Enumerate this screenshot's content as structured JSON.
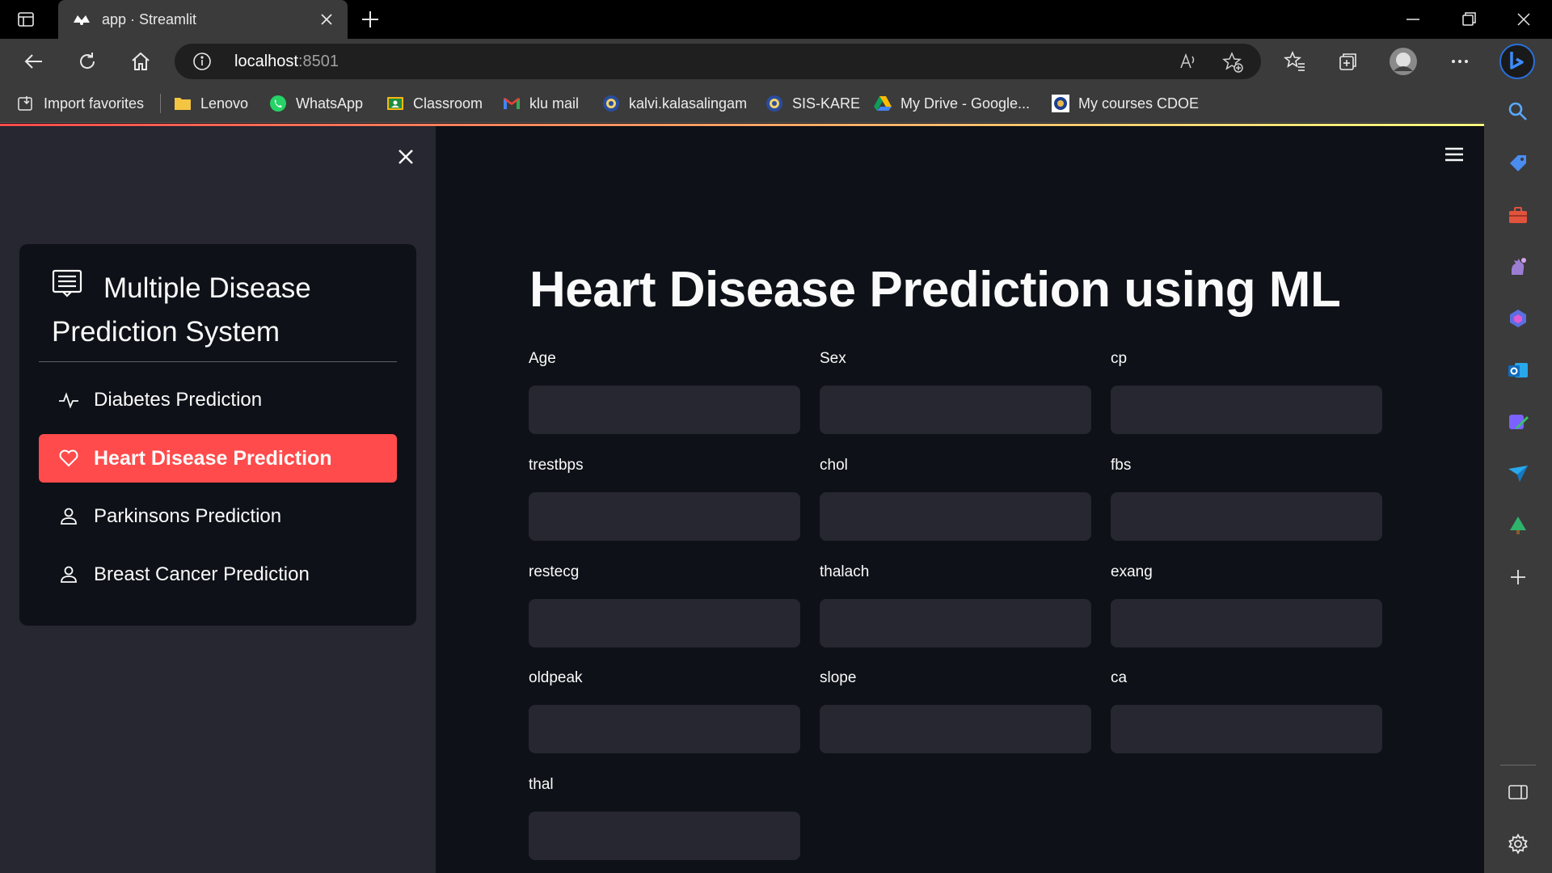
{
  "browser": {
    "tab_title": "app · Streamlit",
    "url_host": "localhost",
    "url_port": ":8501",
    "bookmarks": [
      {
        "label": "Import favorites",
        "icon": "import-icon"
      },
      {
        "label": "Lenovo",
        "icon": "folder-icon"
      },
      {
        "label": "WhatsApp",
        "icon": "whatsapp-icon"
      },
      {
        "label": "Classroom",
        "icon": "classroom-icon"
      },
      {
        "label": "klu mail",
        "icon": "gmail-icon"
      },
      {
        "label": "kalvi.kalasalingam",
        "icon": "kalvi-icon"
      },
      {
        "label": "SIS-KARE",
        "icon": "sis-icon"
      },
      {
        "label": "My Drive - Google...",
        "icon": "drive-icon"
      },
      {
        "label": "My courses CDOE",
        "icon": "cdoe-icon"
      }
    ]
  },
  "sidebar": {
    "menu_title": "Multiple Disease Prediction System",
    "items": [
      {
        "label": "Diabetes Prediction",
        "icon": "activity-icon",
        "active": false
      },
      {
        "label": "Heart Disease Prediction",
        "icon": "heart-icon",
        "active": true
      },
      {
        "label": "Parkinsons Prediction",
        "icon": "person-icon",
        "active": false
      },
      {
        "label": "Breast Cancer Prediction",
        "icon": "person-icon",
        "active": false
      }
    ]
  },
  "main": {
    "title": "Heart Disease Prediction using ML",
    "fields": [
      {
        "label": "Age",
        "value": ""
      },
      {
        "label": "Sex",
        "value": ""
      },
      {
        "label": "cp",
        "value": ""
      },
      {
        "label": "trestbps",
        "value": ""
      },
      {
        "label": "chol",
        "value": ""
      },
      {
        "label": "fbs",
        "value": ""
      },
      {
        "label": "restecg",
        "value": ""
      },
      {
        "label": "thalach",
        "value": ""
      },
      {
        "label": "exang",
        "value": ""
      },
      {
        "label": "oldpeak",
        "value": ""
      },
      {
        "label": "slope",
        "value": ""
      },
      {
        "label": "ca",
        "value": ""
      },
      {
        "label": "thal",
        "value": ""
      }
    ]
  },
  "colors": {
    "accent": "#ff4b4b",
    "app_background": "#0e1117",
    "sidebar_background": "#262730",
    "input_background": "#262730"
  }
}
